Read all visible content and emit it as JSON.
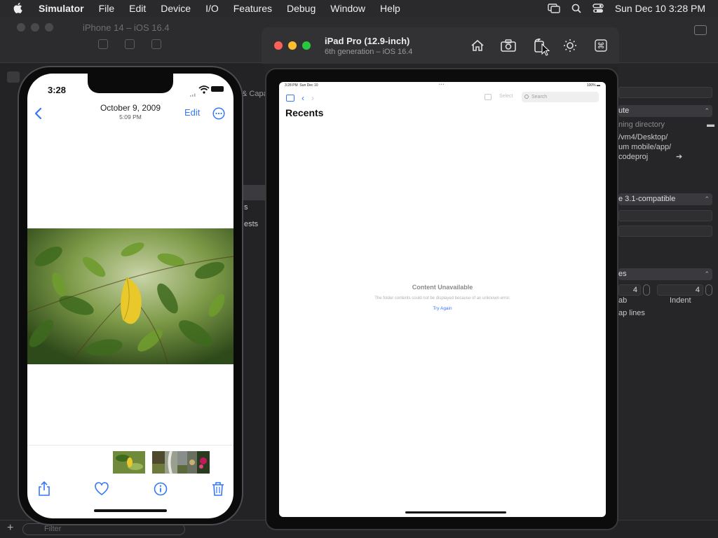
{
  "menubar": {
    "app_name": "Simulator",
    "items": [
      "File",
      "Edit",
      "Device",
      "I/O",
      "Features",
      "Debug",
      "Window",
      "Help"
    ],
    "clock": "Sun Dec 10  3:28 PM"
  },
  "xcode": {
    "window_title": "iPhone 14 – iOS 16.4",
    "caps_label": "& Capa",
    "sidebar_s1": "s",
    "sidebar_s2": "ests",
    "filter_placeholder": "Filter",
    "inspector": {
      "working_dir": "ning directory",
      "path_line1": "/vm4/Desktop/",
      "path_line2": "um mobile/app/",
      "path_line3": "codeproj",
      "compat_popup": "e 3.1-compatible",
      "spaces_popup": "es",
      "tab_value": "4",
      "indent_value": "4",
      "tab_label": "ab",
      "indent_label": "Indent",
      "wrap_label": "ap lines",
      "ute_popup": "ute"
    }
  },
  "ipad": {
    "device_name": "iPad Pro (12.9-inch)",
    "device_sub": "6th generation – iOS 16.4",
    "status_time": "3:28 PM",
    "status_date": "Sun Dec 10",
    "status_battery": "100%",
    "select_label": "Select",
    "search_placeholder": "Search",
    "title": "Recents",
    "empty_title": "Content Unavailable",
    "empty_message": "The folder contents could not be displayed because of an unknown error.",
    "retry_label": "Try Again"
  },
  "iphone": {
    "time": "3:28",
    "photo_date": "October 9, 2009",
    "photo_time": "5:09 PM",
    "edit_label": "Edit"
  },
  "colors": {
    "ios_blue": "#3478f6",
    "traffic_red": "#fe5f57",
    "traffic_yellow": "#febc2e",
    "traffic_green": "#28c840"
  }
}
